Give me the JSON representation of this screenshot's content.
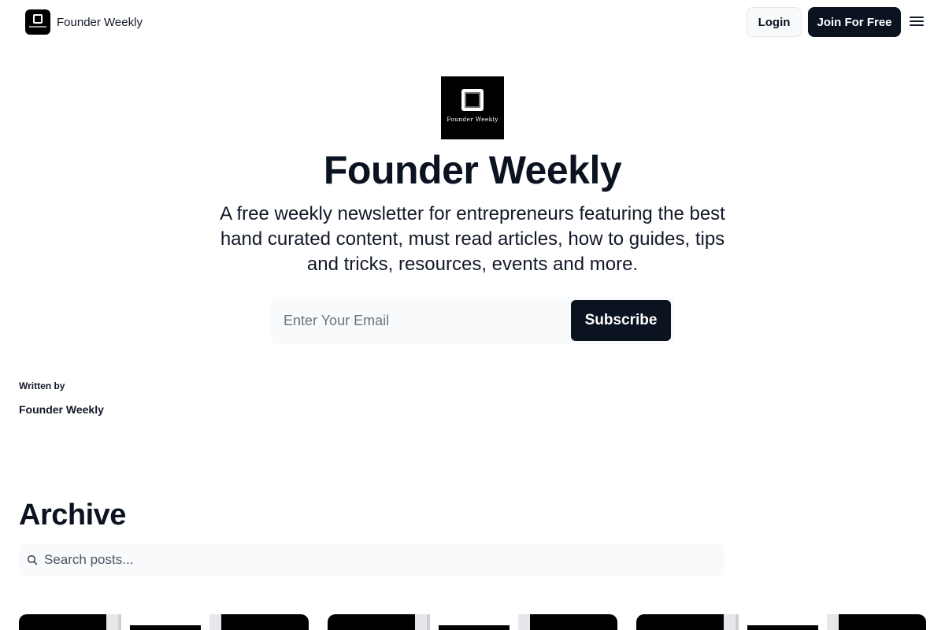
{
  "header": {
    "brand_name": "Founder Weekly",
    "login_label": "Login",
    "join_label": "Join For Free",
    "menu_icon": "hamburger-menu-icon"
  },
  "hero": {
    "logo_caption": "Founder Weekly",
    "title": "Founder Weekly",
    "description": "A free weekly newsletter for entrepreneurs featuring the best hand curated content, must read articles, how to guides, tips and tricks, resources, events and more.",
    "email_placeholder": "Enter Your Email",
    "subscribe_label": "Subscribe"
  },
  "author": {
    "label": "Written by",
    "name": "Founder Weekly"
  },
  "archive": {
    "title": "Archive",
    "search_placeholder": "Search posts...",
    "search_icon": "search-icon",
    "post_count_visible": 3
  },
  "colors": {
    "primary_dark": "#0b1220",
    "surface_light": "#f9fafb",
    "border": "#e5e7eb",
    "muted_text": "#6b7280"
  }
}
